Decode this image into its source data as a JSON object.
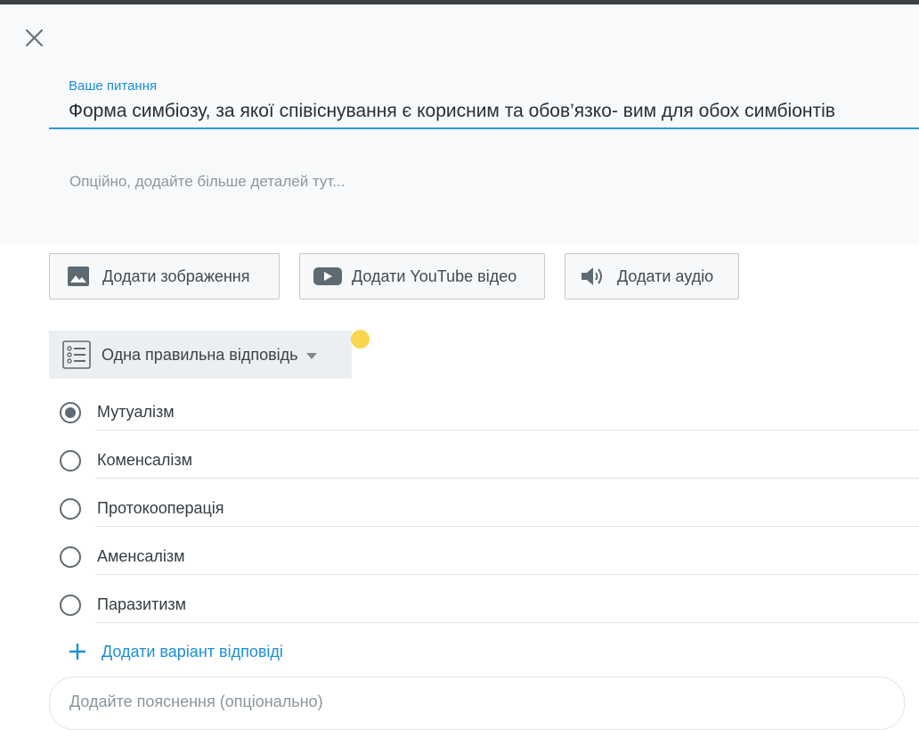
{
  "dialog": {
    "close_icon": "close-icon"
  },
  "question": {
    "label": "Ваше питання",
    "text": "Форма симбіозу, за якої співіснування є корисним та обов’язко- вим для обох симбіонтів",
    "details_placeholder": "Опційно, додайте більше деталей тут..."
  },
  "media_buttons": {
    "image": {
      "label": "Додати зображення",
      "icon": "image-icon"
    },
    "youtube": {
      "label": "Додати YouTube відео",
      "icon": "youtube-icon"
    },
    "audio": {
      "label": "Додати аудіо",
      "icon": "speaker-icon"
    }
  },
  "answer_type": {
    "label": "Одна правильна відповідь",
    "icon": "list-icon"
  },
  "options": [
    {
      "text": "Мутуалізм",
      "selected": true
    },
    {
      "text": "Коменсалізм",
      "selected": false
    },
    {
      "text": "Протокооперація",
      "selected": false
    },
    {
      "text": "Аменсалізм",
      "selected": false
    },
    {
      "text": "Паразитизм",
      "selected": false
    }
  ],
  "add_option": {
    "label": "Додати варіант відповіді",
    "icon": "plus-icon"
  },
  "explanation": {
    "placeholder": "Додайте пояснення (опціонально)"
  },
  "colors": {
    "accent": "#1a8fd6",
    "question_background": "#f7f9fa",
    "cursor_highlight": "#f8d23a"
  }
}
